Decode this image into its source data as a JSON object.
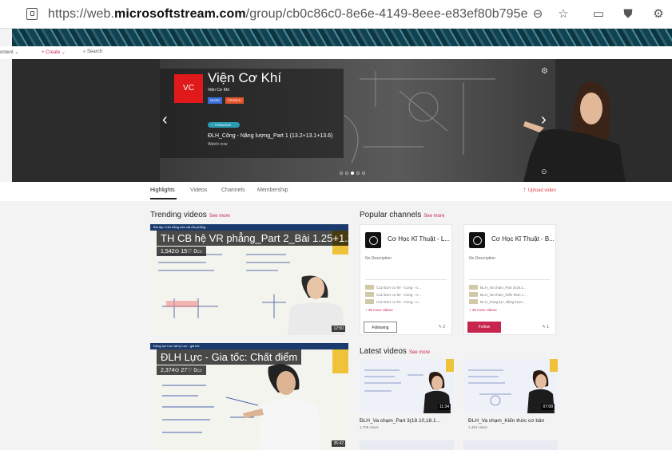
{
  "browser": {
    "url_prefix": "https://web.",
    "url_domain": "microsoftstream.com",
    "url_path": "/group/cb0c86c0-8e6e-4149-8eee-e83ef80b795e"
  },
  "subnav": {
    "content": "ontent ⌄",
    "create": "+ Create ⌄",
    "search": "⌕ Search"
  },
  "hero": {
    "logo": "VC",
    "title": "Viện Cơ Khí",
    "subtitle": "Viện Cơ Khí",
    "badge_1": "MORE",
    "badge_2": "PRIVATE",
    "trending_badge": "✓ TRENDING",
    "video_title": "ĐLH_Công - Năng lượng_Part 1 (13.2+13.1+13.6)",
    "watch": "Watch now",
    "prev": "‹",
    "next": "›",
    "gear": "⚙",
    "settings2": "⊙"
  },
  "tabs": [
    "Highlights",
    "Videos",
    "Channels",
    "Membership"
  ],
  "upload": "⇡ Upload video",
  "trending": {
    "title": "Trending videos",
    "see_more": "See more",
    "videos": [
      {
        "topbar": "Bài tập: Cân bằng của vật rắn phẳng",
        "title": "TH CB hệ VR phẳng_Part 2_Bài 1.25+1.29",
        "stats": "1,542⊙ 15♡ 0▭",
        "duration": "12:50"
      },
      {
        "topbar": "Động lực học vật lý Lực - gia tốc",
        "title": "ĐLH Lực - Gia tốc: Chất điểm",
        "stats": "2,374⊙ 27♡ 0▭",
        "duration": "35:42"
      }
    ]
  },
  "popular": {
    "title": "Popular channels",
    "see_more": "See more",
    "channels": [
      {
        "name": "Cơ Học Kĩ Thuật - L...",
        "desc": "No Description",
        "items": [
          "C11-ĐLH co he - Cong - n...",
          "C11-ĐLH co he - Cong - n...",
          "C11-ĐLH co he - Cong - n..."
        ],
        "more": "+  35 more videos",
        "button": "Following",
        "count": "2"
      },
      {
        "name": "Cơ Học Kĩ Thuật - B...",
        "desc": "No Description",
        "items": [
          "ĐLH_Va cham_Part 3(18.1...",
          "ĐLH_Va cham_Kiến thức c...",
          "ĐLH_Xung lực, động lượn..."
        ],
        "more": "+  30 more videos",
        "button": "Follow",
        "count": "1"
      }
    ]
  },
  "latest": {
    "title": "Latest videos",
    "see_more": "See more",
    "videos": [
      {
        "title": "ĐLH_Va chạm_Part 3(18.10,18.1...",
        "views": "1,708 views",
        "duration": "11:34"
      },
      {
        "title": "ĐLH_Va chạm_Kiến thức cơ bản",
        "views": "1,484 views",
        "duration": "07:08"
      }
    ]
  },
  "colors": {
    "accent": "#c7254e",
    "logo": "#e01a1a",
    "trending": "#2a9bb2"
  }
}
